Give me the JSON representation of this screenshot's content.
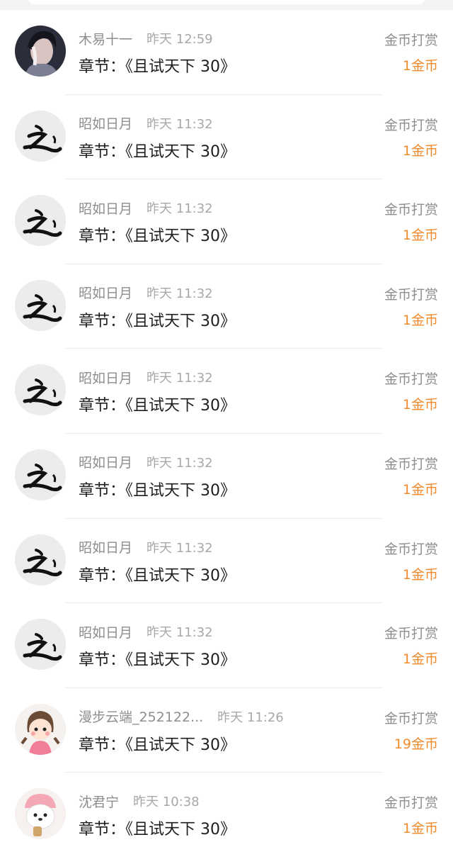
{
  "records": [
    {
      "user": "木易十一",
      "time": "昨天 12:59",
      "chapter": "章节：《且试天下 30》",
      "type": "金币打赏",
      "amount": "1金币",
      "avatar": "portrait-avatar-icon"
    },
    {
      "user": "昭如日月",
      "time": "昨天 11:32",
      "chapter": "章节：《且试天下 30》",
      "type": "金币打赏",
      "amount": "1金币",
      "avatar": "calligraphy-avatar-icon"
    },
    {
      "user": "昭如日月",
      "time": "昨天 11:32",
      "chapter": "章节：《且试天下 30》",
      "type": "金币打赏",
      "amount": "1金币",
      "avatar": "calligraphy-avatar-icon"
    },
    {
      "user": "昭如日月",
      "time": "昨天 11:32",
      "chapter": "章节：《且试天下 30》",
      "type": "金币打赏",
      "amount": "1金币",
      "avatar": "calligraphy-avatar-icon"
    },
    {
      "user": "昭如日月",
      "time": "昨天 11:32",
      "chapter": "章节：《且试天下 30》",
      "type": "金币打赏",
      "amount": "1金币",
      "avatar": "calligraphy-avatar-icon"
    },
    {
      "user": "昭如日月",
      "time": "昨天 11:32",
      "chapter": "章节：《且试天下 30》",
      "type": "金币打赏",
      "amount": "1金币",
      "avatar": "calligraphy-avatar-icon"
    },
    {
      "user": "昭如日月",
      "time": "昨天 11:32",
      "chapter": "章节：《且试天下 30》",
      "type": "金币打赏",
      "amount": "1金币",
      "avatar": "calligraphy-avatar-icon"
    },
    {
      "user": "昭如日月",
      "time": "昨天 11:32",
      "chapter": "章节：《且试天下 30》",
      "type": "金币打赏",
      "amount": "1金币",
      "avatar": "calligraphy-avatar-icon"
    },
    {
      "user": "漫步云端_252122...",
      "time": "昨天 11:26",
      "chapter": "章节：《且试天下 30》",
      "type": "金币打赏",
      "amount": "19金币",
      "avatar": "cartoon-girl-avatar-icon"
    },
    {
      "user": "沈君宁",
      "time": "昨天 10:38",
      "chapter": "章节：《且试天下 30》",
      "type": "金币打赏",
      "amount": "1金币",
      "avatar": "cartoon-bear-avatar-icon"
    }
  ],
  "colors": {
    "amount": "#f08a2a",
    "muted": "#8e8e8e",
    "text": "#1e1e1e"
  }
}
